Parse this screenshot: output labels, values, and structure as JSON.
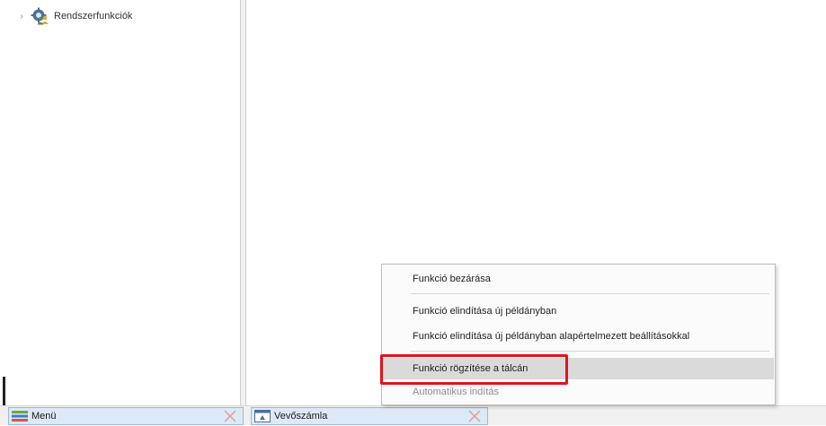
{
  "tree": {
    "items": [
      {
        "label": "Rendszerfunkciók",
        "icon": "gear-users-icon",
        "expander": "›"
      }
    ]
  },
  "taskbar": {
    "tabs": [
      {
        "label": "Menü",
        "icon": "menu-icon"
      },
      {
        "label": "Vevőszámla",
        "icon": "window-icon"
      }
    ]
  },
  "context_menu": {
    "items": [
      {
        "label": "Funkció bezárása"
      },
      {
        "label": "Funkció elindítása új példányban"
      },
      {
        "label": "Funkció elindítása új példányban alapértelmezett beállításokkal"
      },
      {
        "label": "Funkció rögzítése a tálcán",
        "highlighted": true
      },
      {
        "label": "Automatikus indítás",
        "disabled": true
      }
    ]
  },
  "colors": {
    "highlight_border": "#e0141e",
    "tab_background": "#dde9f6",
    "close_x": "#e49a9a"
  }
}
